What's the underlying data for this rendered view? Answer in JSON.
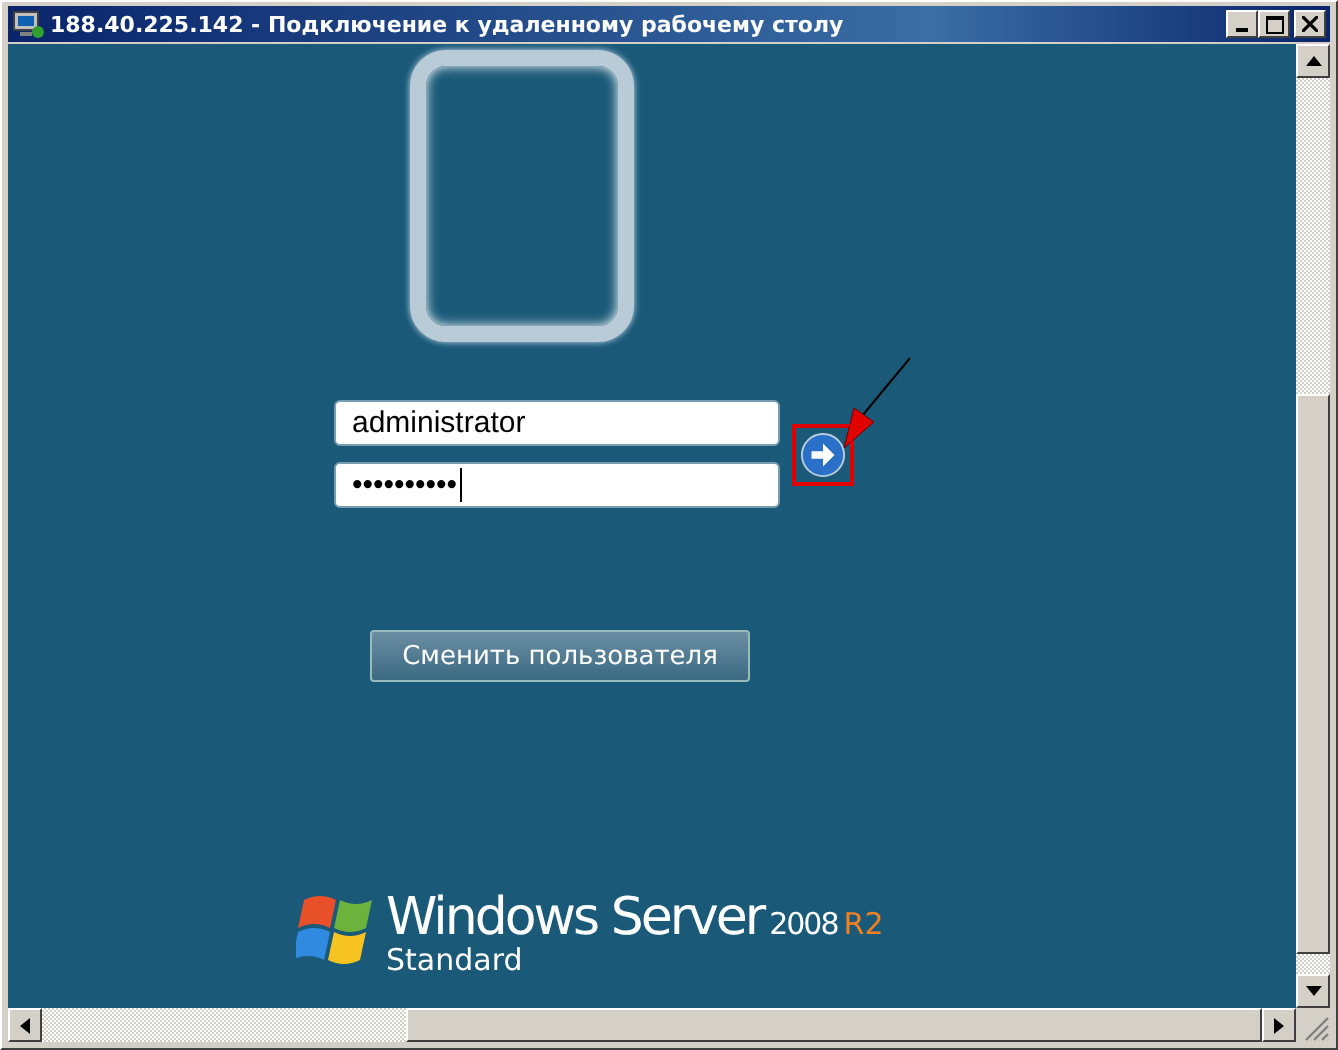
{
  "window": {
    "title": "188.40.225.142 - Подключение к удаленному рабочему столу"
  },
  "login": {
    "username": {
      "value": "administrator"
    },
    "password": {
      "value": "••••••••••",
      "focused": true
    }
  },
  "switch_user_button": {
    "label": "Сменить пользователя"
  },
  "logo": {
    "product": "Windows Server",
    "version": "2008",
    "release": "R2",
    "edition": "Standard"
  }
}
